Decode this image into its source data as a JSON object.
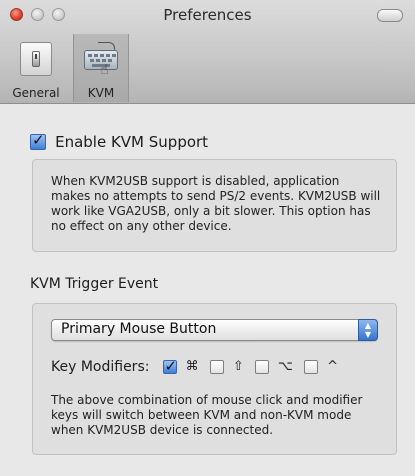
{
  "window": {
    "title": "Preferences"
  },
  "toolbar": {
    "items": [
      {
        "label": "General",
        "icon": "general-switch-icon",
        "selected": false
      },
      {
        "label": "KVM",
        "icon": "keyboard-icon",
        "selected": true
      }
    ]
  },
  "kvm": {
    "enable": {
      "label": "Enable KVM Support",
      "checked": true
    },
    "enable_description": "When KVM2USB support is disabled, application makes no attempts to send PS/2 events. KVM2USB will work like VGA2USB, only a bit slower. This option has no effect on any other device.",
    "trigger_section_title": "KVM Trigger Event",
    "trigger_popup": {
      "selected": "Primary Mouse Button"
    },
    "modifiers": {
      "label": "Key Modifiers:",
      "items": [
        {
          "symbol": "⌘",
          "name": "command",
          "checked": true
        },
        {
          "symbol": "⇧",
          "name": "shift",
          "checked": false
        },
        {
          "symbol": "⌥",
          "name": "option",
          "checked": false
        },
        {
          "symbol": "^",
          "name": "control",
          "checked": false
        }
      ]
    },
    "trigger_description": "The above combination of mouse click and modifier keys will switch between KVM and non-KVM mode when KVM2USB device is connected."
  }
}
